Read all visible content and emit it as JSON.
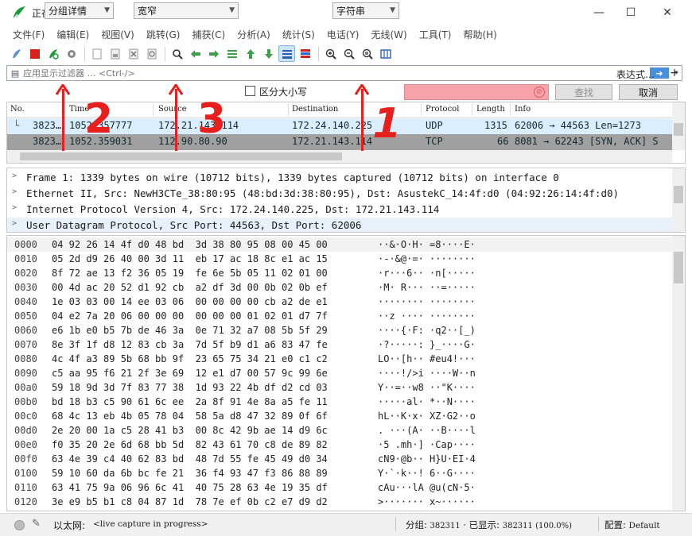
{
  "window": {
    "title": "正在捕获 以太网",
    "minimize": "—",
    "maximize": "☐",
    "close": "✕"
  },
  "menu": [
    "文件(F)",
    "编辑(E)",
    "视图(V)",
    "跳转(G)",
    "捕获(C)",
    "分析(A)",
    "统计(S)",
    "电话(Y)",
    "无线(W)",
    "工具(T)",
    "帮助(H)"
  ],
  "toolbar": {
    "icons": [
      "shark-fin-icon",
      "stop-icon",
      "restart-icon",
      "options-gear-icon",
      "open-file-icon",
      "save-file-icon",
      "close-file-icon",
      "reload-icon",
      "find-icon",
      "back-arrow-icon",
      "forward-arrow-icon",
      "goto-packet-icon",
      "first-packet-icon",
      "last-packet-icon",
      "autoscroll-icon",
      "colorize-icon",
      "zoom-in-icon",
      "zoom-out-icon",
      "zoom-reset-icon",
      "resize-columns-icon"
    ]
  },
  "filter": {
    "placeholder": "应用显示过滤器 … <Ctrl-/>",
    "apply_glyph": "➜",
    "dropdown_glyph": "▾",
    "expression_label": "表达式…",
    "add_glyph": "+"
  },
  "find": {
    "search_in": "分组详情",
    "char_width": "宽窄",
    "case_sensitive_label": "区分大小写",
    "search_type": "字符串",
    "query": "",
    "clear_glyph": "⊘",
    "find_button": "查找",
    "cancel_button": "取消"
  },
  "packet_list": {
    "columns": [
      "No.",
      "Time",
      "Source",
      "Destination",
      "Protocol",
      "Length",
      "Info"
    ],
    "rows": [
      {
        "tree": "└",
        "no": "3823…",
        "time": "1052.357777",
        "source": "172.21.143.114",
        "destination": "172.24.140.225",
        "protocol": "UDP",
        "length": "1315",
        "info": "62006 → 44563 Len=1273"
      },
      {
        "tree": "",
        "no": "3823…",
        "time": "1052.359031",
        "source": "112.90.80.90",
        "destination": "172.21.143.114",
        "protocol": "TCP",
        "length": "66",
        "info": "8081 → 62243 [SYN, ACK] S"
      }
    ]
  },
  "annotations": {
    "label_1": "1",
    "label_2": "2",
    "label_3": "3",
    "color": "#e8201d"
  },
  "details": [
    "Frame 1: 1339 bytes on wire (10712 bits), 1339 bytes captured (10712 bits) on interface 0",
    "Ethernet II, Src: NewH3CTe_38:80:95 (48:bd:3d:38:80:95), Dst: AsustekC_14:4f:d0 (04:92:26:14:4f:d0)",
    "Internet Protocol Version 4, Src: 172.24.140.225, Dst: 172.21.143.114",
    "User Datagram Protocol, Src Port: 44563, Dst Port: 62006"
  ],
  "bytes": [
    {
      "off": "0000",
      "hex": "04 92 26 14 4f d0 48 bd  3d 38 80 95 08 00 45 00",
      "asc": "··&·O·H· =8····E·"
    },
    {
      "off": "0010",
      "hex": "05 2d d9 26 40 00 3d 11  eb 17 ac 18 8c e1 ac 15",
      "asc": "·-·&@·=· ········"
    },
    {
      "off": "0020",
      "hex": "8f 72 ae 13 f2 36 05 19  fe 6e 5b 05 11 02 01 00",
      "asc": "·r···6·· ·n[·····"
    },
    {
      "off": "0030",
      "hex": "00 4d ac 20 52 d1 92 cb  a2 df 3d 00 0b 02 0b ef",
      "asc": "·M· R··· ··=·····"
    },
    {
      "off": "0040",
      "hex": "1e 03 03 00 14 ee 03 06  00 00 00 00 cb a2 de e1",
      "asc": "········ ········"
    },
    {
      "off": "0050",
      "hex": "04 e2 7a 20 06 00 00 00  00 00 00 01 02 01 d7 7f",
      "asc": "··z ···· ········"
    },
    {
      "off": "0060",
      "hex": "e6 1b e0 b5 7b de 46 3a  0e 71 32 a7 08 5b 5f 29",
      "asc": "····{·F: ·q2··[_)"
    },
    {
      "off": "0070",
      "hex": "8e 3f 1f d8 12 83 cb 3a  7d 5f b9 d1 a6 83 47 fe",
      "asc": "·?·····: }_····G·"
    },
    {
      "off": "0080",
      "hex": "4c 4f a3 89 5b 68 bb 9f  23 65 75 34 21 e0 c1 c2",
      "asc": "LO··[h·· #eu4!···"
    },
    {
      "off": "0090",
      "hex": "c5 aa 95 f6 21 2f 3e 69  12 e1 d7 00 57 9c 99 6e",
      "asc": "····!/>i ····W··n"
    },
    {
      "off": "00a0",
      "hex": "59 18 9d 3d 7f 83 77 38  1d 93 22 4b df d2 cd 03",
      "asc": "Y··=··w8 ··\"K····"
    },
    {
      "off": "00b0",
      "hex": "bd 18 b3 c5 90 61 6c ee  2a 8f 91 4e 8a a5 fe 11",
      "asc": "·····al· *··N····"
    },
    {
      "off": "00c0",
      "hex": "68 4c 13 eb 4b 05 78 04  58 5a d8 47 32 89 0f 6f",
      "asc": "hL··K·x· XZ·G2··o"
    },
    {
      "off": "00d0",
      "hex": "2e 20 00 1a c5 28 41 b3  00 8c 42 9b ae 14 d9 6c",
      "asc": ". ···(A· ··B····l"
    },
    {
      "off": "00e0",
      "hex": "f0 35 20 2e 6d 68 bb 5d  82 43 61 70 c8 de 89 82",
      "asc": "·5 .mh·] ·Cap····"
    },
    {
      "off": "00f0",
      "hex": "63 4e 39 c4 40 62 83 bd  48 7d 55 fe 45 49 d0 34",
      "asc": "cN9·@b·· H}U·EI·4"
    },
    {
      "off": "0100",
      "hex": "59 10 60 da 6b bc fe 21  36 f4 93 47 f3 86 88 89",
      "asc": "Y·`·k··! 6··G····"
    },
    {
      "off": "0110",
      "hex": "63 41 75 9a 06 96 6c 41  40 75 28 63 4e 19 35 df",
      "asc": "cAu···lA @u(cN·5·"
    },
    {
      "off": "0120",
      "hex": "3e e9 b5 b1 c8 04 87 1d  78 7e ef 0b c2 e7 d9 d2",
      "asc": ">······· x~······"
    }
  ],
  "status": {
    "interface": "以太网:",
    "capture_state": "<live capture in progress>",
    "packets_label": "分组:",
    "packets_value": "382311",
    "displayed_label": "· 已显示:",
    "displayed_value": "382311 (100.0%)",
    "profile_label": "配置:",
    "profile_value": "Default"
  }
}
